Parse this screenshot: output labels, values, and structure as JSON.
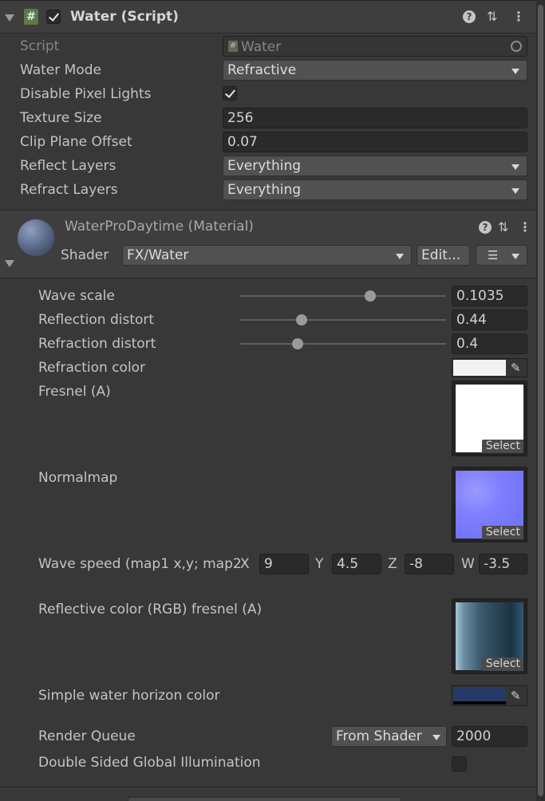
{
  "script_component": {
    "icon_label": "#",
    "title": "Water (Script)",
    "fields": {
      "script_label": "Script",
      "script_value": "Water",
      "script_icon_label": "#",
      "water_mode_label": "Water Mode",
      "water_mode_value": "Refractive",
      "disable_pixel_lights_label": "Disable Pixel Lights",
      "disable_pixel_lights_checked": true,
      "texture_size_label": "Texture Size",
      "texture_size_value": "256",
      "clip_plane_offset_label": "Clip Plane Offset",
      "clip_plane_offset_value": "0.07",
      "reflect_layers_label": "Reflect Layers",
      "reflect_layers_value": "Everything",
      "refract_layers_label": "Refract Layers",
      "refract_layers_value": "Everything"
    },
    "header_icons": [
      "help-icon",
      "presets-icon",
      "kebab-menu-icon"
    ]
  },
  "material": {
    "title": "WaterProDaytime (Material)",
    "shader_label": "Shader",
    "shader_value": "FX/Water",
    "edit_button": "Edit...",
    "properties": {
      "wave_scale_label": "Wave scale",
      "wave_scale_value": "0.1035",
      "wave_scale_fraction": 0.63,
      "reflection_distort_label": "Reflection distort",
      "reflection_distort_value": "0.44",
      "reflection_distort_fraction": 0.3,
      "refraction_distort_label": "Refraction distort",
      "refraction_distort_value": "0.4",
      "refraction_distort_fraction": 0.28,
      "refraction_color_label": "Refraction color",
      "refraction_color_hex": "#f2f2f2",
      "fresnel_label": "Fresnel (A)",
      "normalmap_label": "Normalmap",
      "select_label": "Select",
      "wave_speed_label": "Wave speed (map1 x,y; map2",
      "wave_speed": {
        "x_label": "X",
        "x_value": "9",
        "y_label": "Y",
        "y_value": "4.5",
        "z_label": "Z",
        "z_value": "-8",
        "w_label": "W",
        "w_value": "-3.5"
      },
      "reflective_color_label": "Reflective color (RGB) fresnel (A)",
      "horizon_color_label": "Simple water horizon color",
      "horizon_color_hex": "#253a66",
      "render_queue_label": "Render Queue",
      "render_queue_mode": "From Shader",
      "render_queue_value": "2000",
      "double_sided_gi_label": "Double Sided Global Illumination",
      "double_sided_gi_checked": false
    }
  },
  "colors": {
    "background": "#383838",
    "header": "#3e3e3e",
    "field": "#2a2a2a",
    "dropdown": "#515151",
    "text": "#c4c4c4",
    "normalmap_tint": "#7d7dff"
  }
}
